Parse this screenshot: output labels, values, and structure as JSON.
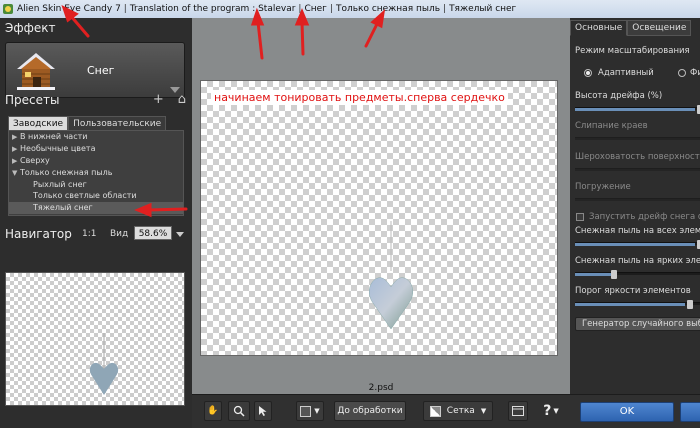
{
  "title_bar": {
    "app": "Alien Skin Eye Candy 7",
    "translation": "Translation of the program : Stalevar",
    "effect": "Снег",
    "preset_group": "Только снежная пыль",
    "preset": "Тяжелый снег"
  },
  "left_panel": {
    "effect_heading": "Эффект",
    "effect_name": "Снег",
    "presets_heading": "Пресеты",
    "tabs": [
      "Заводские",
      "Пользовательские"
    ],
    "active_tab": 0,
    "tree": [
      {
        "label": "В нижней части",
        "level": 0,
        "arrow": "▶"
      },
      {
        "label": "Необычные цвета",
        "level": 0,
        "arrow": "▶"
      },
      {
        "label": "Сверху",
        "level": 0,
        "arrow": "▶"
      },
      {
        "label": "Только снежная пыль",
        "level": 0,
        "arrow": "▼"
      },
      {
        "label": "Рыхлый снег",
        "level": 1,
        "arrow": ""
      },
      {
        "label": "Только светлые области",
        "level": 1,
        "arrow": ""
      },
      {
        "label": "Тяжелый снег",
        "level": 1,
        "arrow": "",
        "selected": true
      }
    ],
    "navigator_heading": "Навигатор",
    "zoom_one_to_one": "1:1",
    "view_label": "Вид",
    "zoom_value": "58.6%"
  },
  "center": {
    "annotation": "начинаем тонировать предметы.сперва сердечко",
    "filename": "2.psd",
    "before_processing_label": "До обработки",
    "grid_label": "Сетка"
  },
  "right_panel": {
    "tabs": [
      "Основные",
      "Освещение"
    ],
    "scaling_mode_label": "Режим масштабирования",
    "radio_adaptive": "Адаптивный",
    "radio_fixed": "Фи",
    "drift_height": "Высота дрейфа (%)",
    "edge_sticking": "Слипание краев",
    "surface_roughness": "Шероховатость поверхности",
    "immersion": "Погружение",
    "start_drift": "Запустить дрейф снега от о",
    "dust_all": "Снежная пыль на всех элемент",
    "dust_bright": "Снежная пыль на ярких элемен",
    "brightness_threshold": "Порог яркости элементов",
    "random_gen": "Генератор случайного выбора",
    "ok_label": "OK",
    "accent": "#3a6fc0"
  },
  "colors": {
    "annotation_text": "#e01010",
    "arrow_red": "#e02020"
  }
}
